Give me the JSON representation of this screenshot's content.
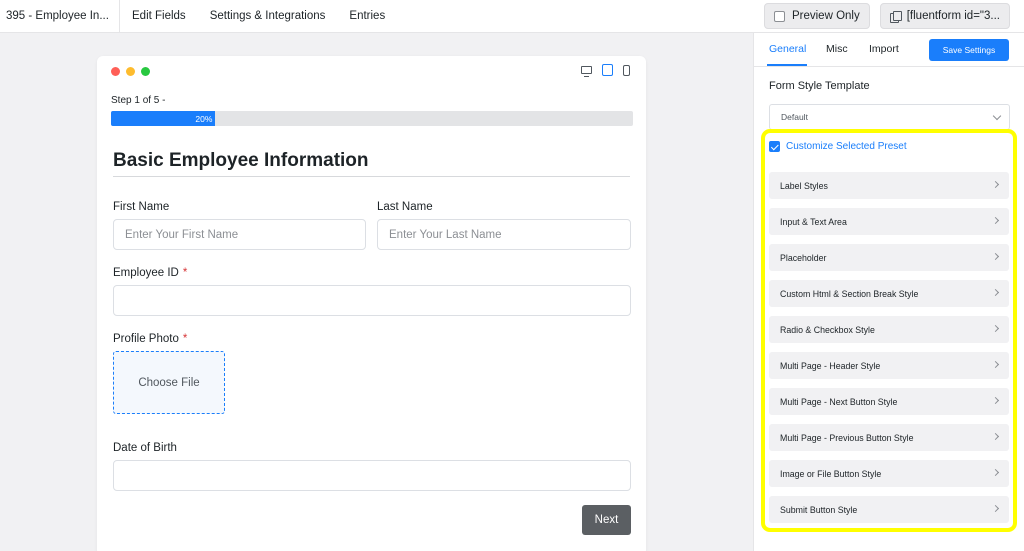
{
  "topbar": {
    "title": "395 - Employee In...",
    "nav": [
      "Edit Fields",
      "Settings & Integrations",
      "Entries"
    ],
    "preview_label": "Preview Only",
    "shortcode_label": "[fluentform id=\"3..."
  },
  "form": {
    "step_text": "Step 1 of 5 -",
    "progress": {
      "value": 20,
      "label": "20%"
    },
    "heading": "Basic Employee Information",
    "first_name_label": "First Name",
    "first_name_placeholder": "Enter Your First Name",
    "last_name_label": "Last Name",
    "last_name_placeholder": "Enter Your Last Name",
    "employee_id_label": "Employee ID",
    "profile_photo_label": "Profile Photo",
    "choose_file_label": "Choose File",
    "dob_label": "Date of Birth",
    "required_mark": "*",
    "next_label": "Next"
  },
  "panel": {
    "tabs": [
      "General",
      "Misc",
      "Import"
    ],
    "active_tab": "General",
    "save_label": "Save Settings",
    "template_label": "Form Style Template",
    "template_value": "Default",
    "preset_label": "Customize Selected Preset",
    "preset_checked": true,
    "style_items": [
      "Label Styles",
      "Input & Text Area",
      "Placeholder",
      "Custom Html & Section Break Style",
      "Radio & Checkbox Style",
      "Multi Page - Header Style",
      "Multi Page - Next Button Style",
      "Multi Page - Previous Button Style",
      "Image or File Button Style",
      "Submit Button Style"
    ]
  },
  "colors": {
    "accent": "#1a7efb",
    "highlight": "#ffff00",
    "required": "#d63638",
    "window_dots": [
      "#ff5f57",
      "#febc2e",
      "#28c840"
    ]
  },
  "icons": [
    "checkbox-icon",
    "copy-icon",
    "desktop-icon",
    "tablet-icon",
    "mobile-icon",
    "chevron-right-icon",
    "chevron-down-icon"
  ]
}
